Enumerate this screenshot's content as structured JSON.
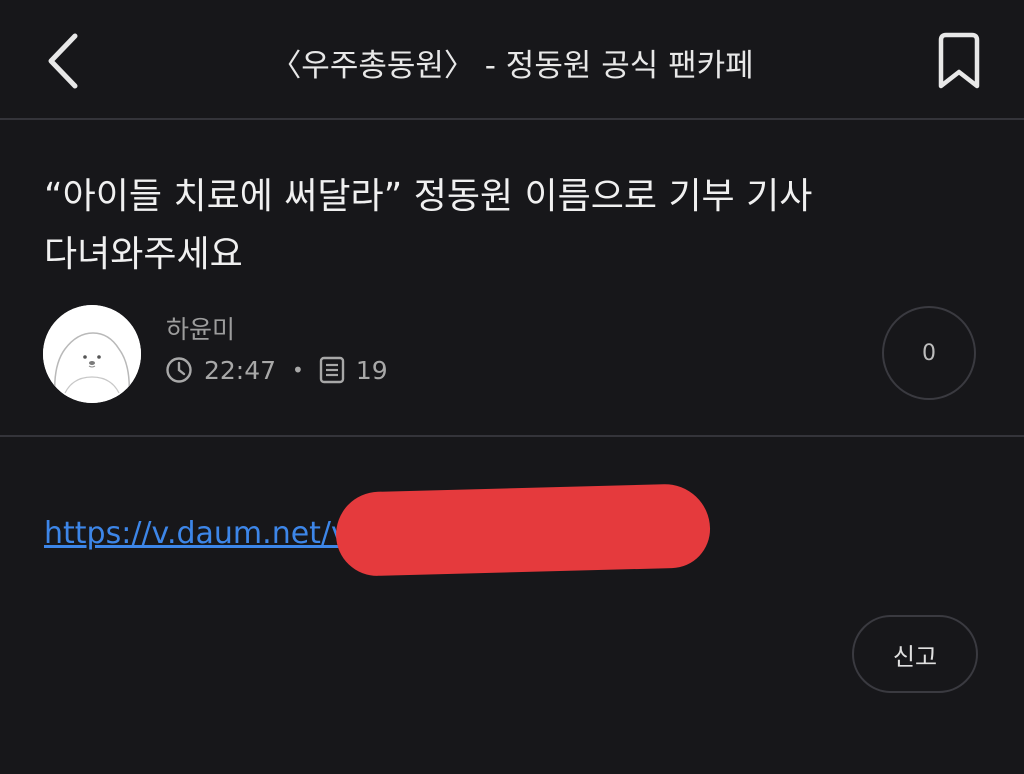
{
  "header": {
    "cafe_title": "〈우주총동원〉 - 정동원 공식 팬카페",
    "back_icon": "chevron-left-icon",
    "bookmark_icon": "bookmark-icon"
  },
  "post": {
    "title": "“아이들 치료에 써달라” 정동원 이름으로 기부 기사 다녀와주세요",
    "author": "하윤미",
    "time": "22:47",
    "views": "19",
    "like_count": "0",
    "link_text": "https://v.daum.net/v/"
  },
  "actions": {
    "report_label": "신고"
  },
  "colors": {
    "background": "#17171a",
    "link": "#3d86e8",
    "redaction": "#e53a3d",
    "divider": "#34343a"
  }
}
